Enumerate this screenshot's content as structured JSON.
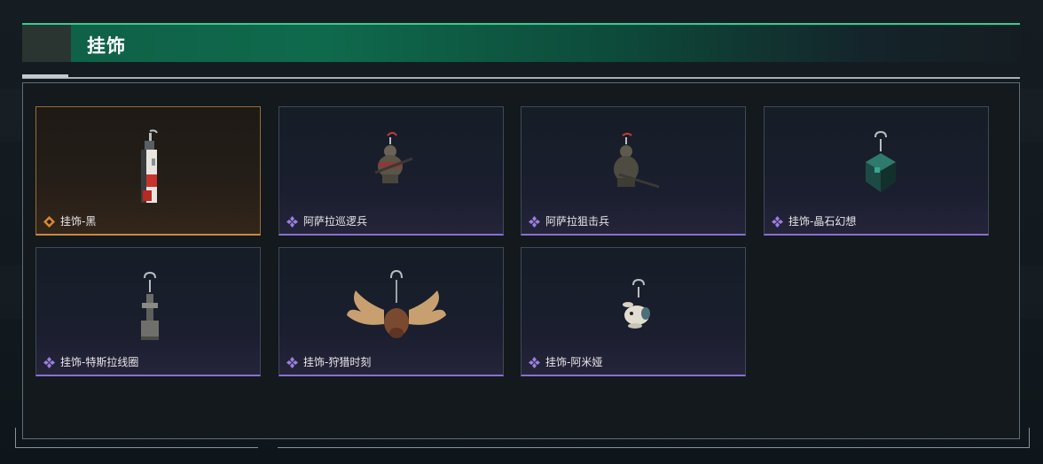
{
  "header": {
    "title": "挂饰"
  },
  "colors": {
    "accent": "#2fd08f",
    "rare": "#8a6fd4",
    "legendary": "#c88a3e"
  },
  "items": [
    {
      "label": "挂饰-黑",
      "rarity": "legendary",
      "icon": "tall-tag-charm-icon"
    },
    {
      "label": "阿萨拉巡逻兵",
      "rarity": "rare",
      "icon": "soldier-figure-charm-icon"
    },
    {
      "label": "阿萨拉狙击兵",
      "rarity": "rare",
      "icon": "sniper-figure-charm-icon"
    },
    {
      "label": "挂饰-晶石幻想",
      "rarity": "rare",
      "icon": "crystal-cube-charm-icon"
    },
    {
      "label": "挂饰-特斯拉线圈",
      "rarity": "rare",
      "icon": "tesla-coil-charm-icon"
    },
    {
      "label": "挂饰-狩猎时刻",
      "rarity": "rare",
      "icon": "moose-antler-charm-icon"
    },
    {
      "label": "挂饰-阿米娅",
      "rarity": "rare",
      "icon": "bunny-charm-icon"
    }
  ]
}
